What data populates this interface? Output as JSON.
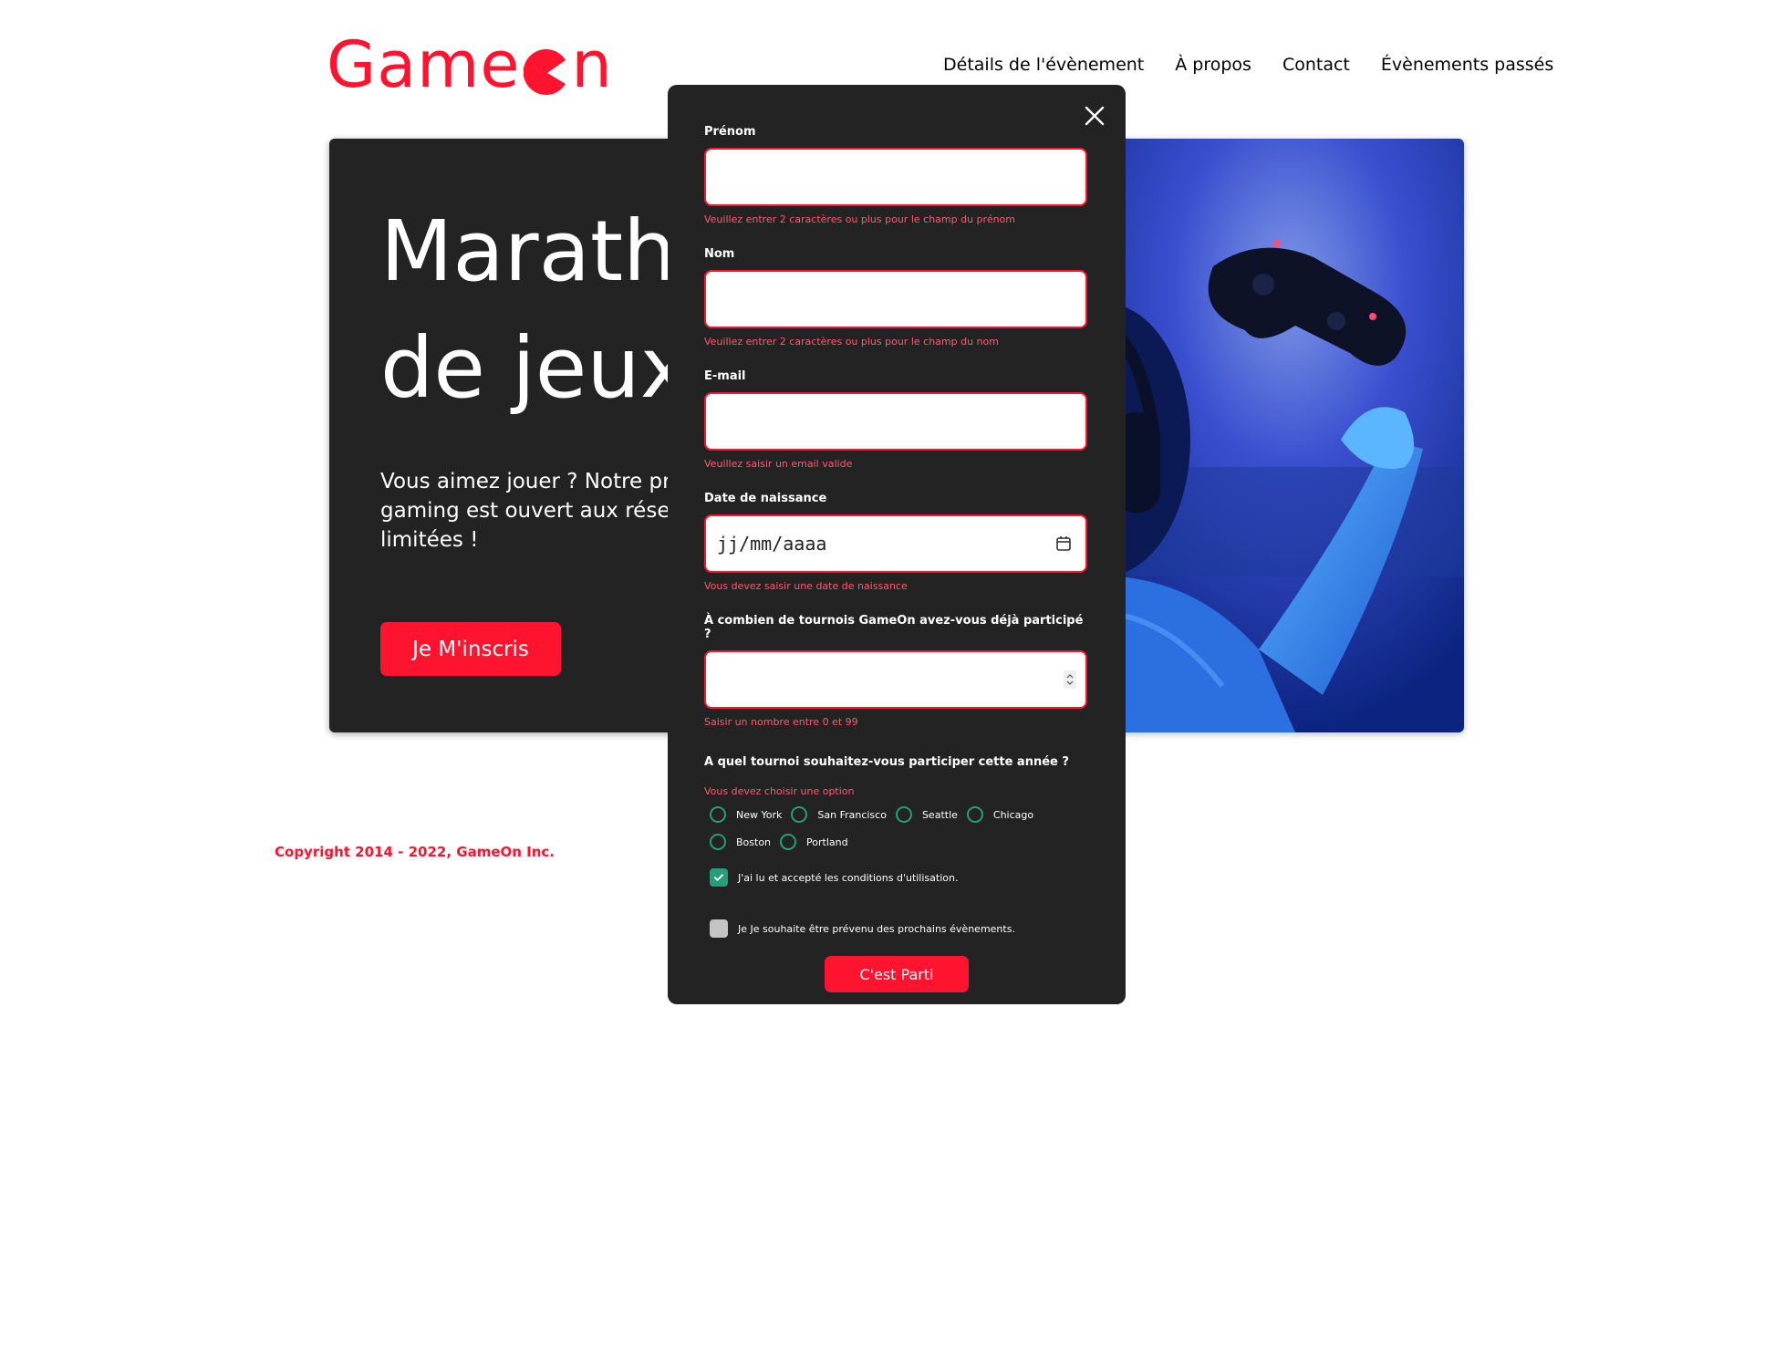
{
  "brand": {
    "name_prefix": "Game",
    "name_suffix": "n",
    "color": "#fe142f"
  },
  "nav": {
    "items": [
      {
        "label": "Détails de l'évènement"
      },
      {
        "label": "À propos"
      },
      {
        "label": "Contact"
      },
      {
        "label": "Évènements passés"
      }
    ]
  },
  "hero": {
    "title_line1": "Marathon national",
    "title_line2": "de jeux vidéos",
    "text": "Vous aimez jouer ? Notre prochain évènement gaming est ouvert aux réservations... Places limitées !",
    "button_label": "Je M'inscris",
    "image_icon": "gamer-controller-photo"
  },
  "footer": {
    "copyright": "Copyright 2014 - 2022, GameOn Inc."
  },
  "modal": {
    "close_icon": "close-icon",
    "fields": {
      "first_name": {
        "label": "Prénom",
        "value": "",
        "error": "Veuillez entrer 2 caractères ou plus pour le champ du prénom"
      },
      "last_name": {
        "label": "Nom",
        "value": "",
        "error": "Veuillez entrer 2 caractères ou plus pour le champ du nom"
      },
      "email": {
        "label": "E-mail",
        "value": "",
        "error": "Veuillez saisir un email valide"
      },
      "birthdate": {
        "label": "Date de naissance",
        "placeholder": "jj/mm/aaaa",
        "error": "Vous devez saisir une date de naissance"
      },
      "quantity": {
        "label": "À combien de tournois GameOn avez-vous déjà participé ?",
        "value": "",
        "error": "Saisir un nombre entre 0 et 99"
      }
    },
    "location": {
      "question": "A quel tournoi souhaitez-vous participer cette année ?",
      "error": "Vous devez choisir une option",
      "options": [
        "New York",
        "San Francisco",
        "Seattle",
        "Chicago",
        "Boston",
        "Portland"
      ]
    },
    "checkbox_terms": {
      "label": "J'ai lu et accepté les conditions d'utilisation.",
      "checked": true
    },
    "checkbox_news": {
      "label": "Je Je souhaite être prévenu des prochains évènements.",
      "checked": false
    },
    "submit_label": "C'est Parti"
  },
  "colors": {
    "accent": "#fe142f",
    "modal_bg": "#232323",
    "radio": "#279e7a",
    "error_text": "#fe5a6d"
  }
}
